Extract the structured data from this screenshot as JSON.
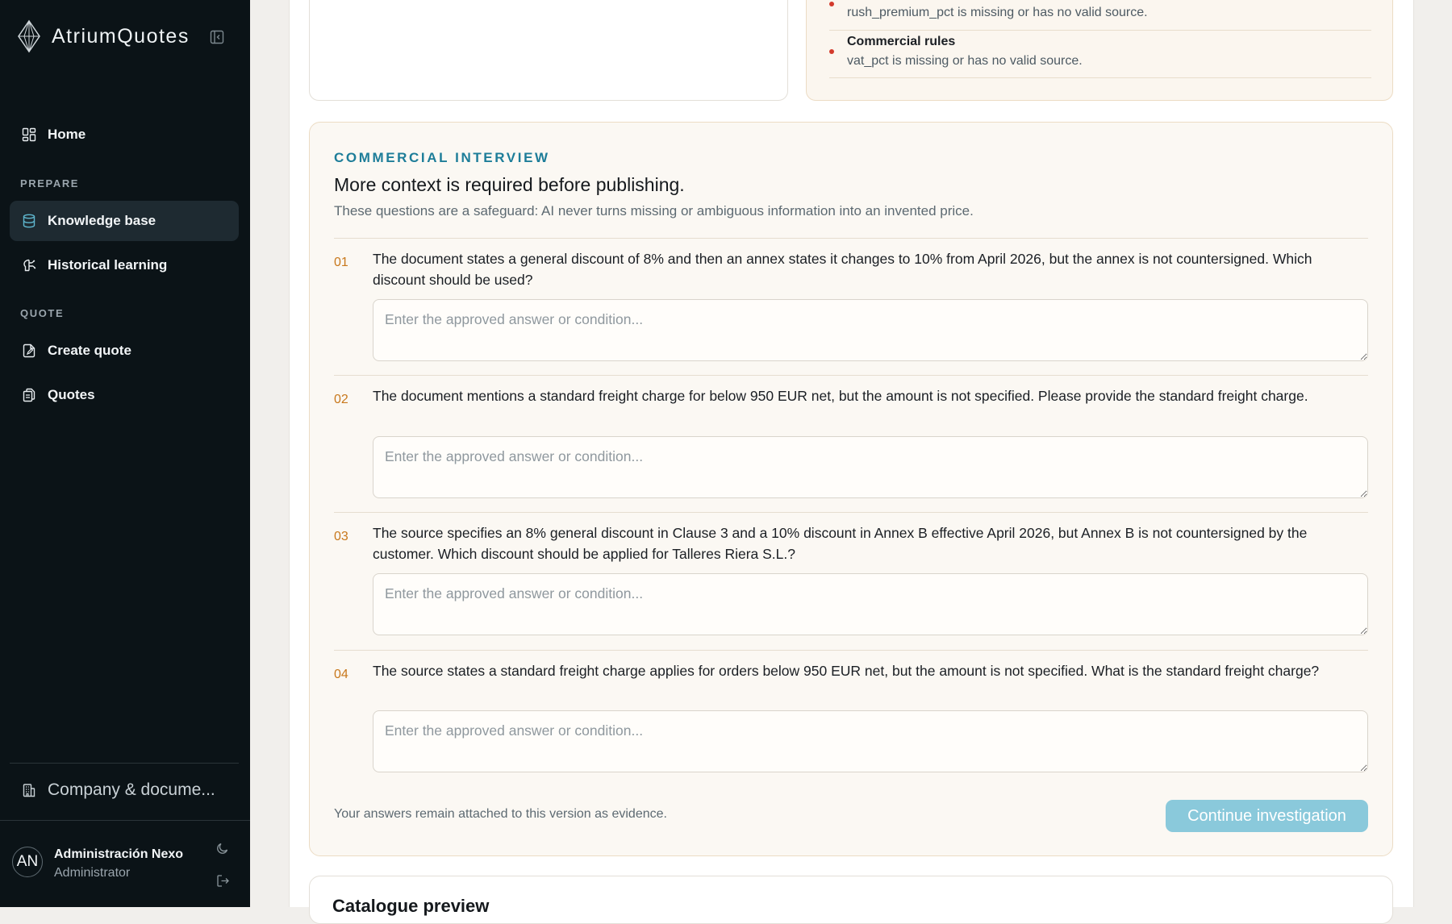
{
  "app": {
    "name": "AtriumQuotes"
  },
  "sidebar": {
    "home_label": "Home",
    "prepare_section": "PREPARE",
    "knowledge_base_label": "Knowledge base",
    "historical_learning_label": "Historical learning",
    "quote_section": "QUOTE",
    "create_quote_label": "Create quote",
    "quotes_label": "Quotes",
    "company_label": "Company & docume...",
    "active_item": "Knowledge base"
  },
  "user": {
    "initials": "AN",
    "name": "Administración Nexo",
    "role": "Administrator"
  },
  "issues": [
    {
      "title": "",
      "description": "rush_premium_pct is missing or has no valid source."
    },
    {
      "title": "Commercial rules",
      "description": "vat_pct is missing or has no valid source."
    }
  ],
  "interview": {
    "eyebrow": "COMMERCIAL INTERVIEW",
    "heading": "More context is required before publishing.",
    "subheading": "These questions are a safeguard: AI never turns missing or ambiguous information into an invented price.",
    "questions": [
      {
        "number": "01",
        "text": "The document states a general discount of 8% and then an annex states it changes to 10% from April 2026, but the annex is not countersigned. Which discount should be used?",
        "answer": "",
        "placeholder": "Enter the approved answer or condition..."
      },
      {
        "number": "02",
        "text": "The document mentions a standard freight charge for below 950 EUR net, but the amount is not specified. Please provide the standard freight charge.",
        "answer": "",
        "placeholder": "Enter the approved answer or condition..."
      },
      {
        "number": "03",
        "text": "The source specifies an 8% general discount in Clause 3 and a 10% discount in Annex B effective April 2026, but Annex B is not countersigned by the customer. Which discount should be applied for Talleres Riera S.L.?",
        "answer": "",
        "placeholder": "Enter the approved answer or condition..."
      },
      {
        "number": "04",
        "text": "The source states a standard freight charge applies for orders below 950 EUR net, but the amount is not specified. What is the standard freight charge?",
        "answer": "",
        "placeholder": "Enter the approved answer or condition..."
      }
    ],
    "footer_note": "Your answers remain attached to this version as evidence.",
    "continue_label": "Continue investigation"
  },
  "catalogue": {
    "title": "Catalogue preview"
  },
  "colors": {
    "sidebar_bg": "#0b1317",
    "accent_teal": "#1d7d99",
    "question_number": "#c8781c",
    "issue_dot": "#d33a2c",
    "button_bg": "#8ac9db"
  },
  "icons": {
    "brand": "diamond-logo-icon",
    "collapse": "sidebar-collapse-icon",
    "home": "dashboard-grid-icon",
    "knowledge_base": "database-icon",
    "historical_learning": "brain-icon",
    "create_quote": "document-edit-icon",
    "quotes": "documents-icon",
    "company": "building-icon",
    "theme": "moon-icon",
    "logout": "logout-icon"
  }
}
